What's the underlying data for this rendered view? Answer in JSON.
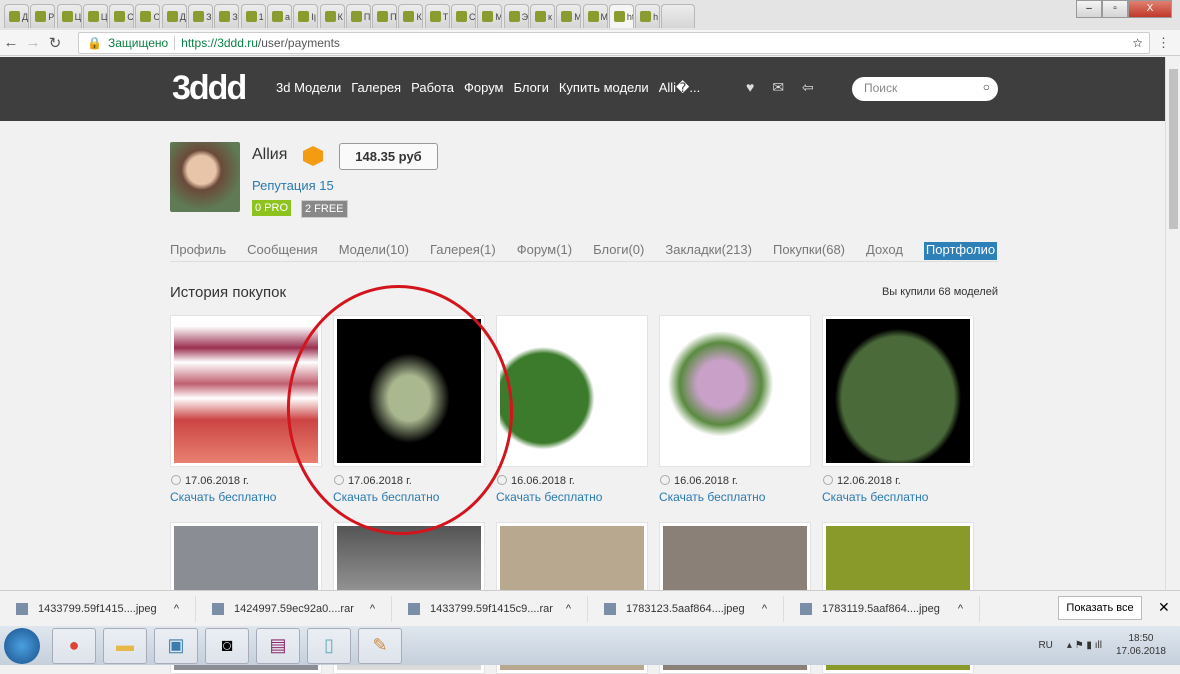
{
  "browser": {
    "tabs": [
      "Д",
      "Р",
      "Ц",
      "Ц",
      "С",
      "О",
      "Д",
      "З",
      "З",
      "1",
      "a",
      "Iן",
      "К",
      "П",
      "П",
      "К",
      "Т",
      "С",
      "М",
      "Э",
      "к",
      "М",
      "М",
      "ht",
      "h"
    ],
    "active_tab": 23,
    "close": "X",
    "secure_label": "Защищено",
    "url_host": "https://3ddd.ru",
    "url_path": "/user/payments"
  },
  "site": {
    "logo": "3ddd",
    "menu": [
      "3d Модели",
      "Галерея",
      "Работа",
      "Форум",
      "Блоги",
      "Купить модели",
      "Alli�..."
    ],
    "search_placeholder": "Поиск"
  },
  "profile": {
    "name": "Allия",
    "balance": "148.35 руб",
    "reputation": "Репутация 15",
    "pro": "0 PRO",
    "free": "2 FREE"
  },
  "tabs": [
    "Профиль",
    "Сообщения",
    "Модели(10)",
    "Галерея(1)",
    "Форум(1)",
    "Блоги(0)",
    "Закладки(213)",
    "Покупки(68)",
    "Доход",
    "Портфолио"
  ],
  "purchases": {
    "title": "История покупок",
    "count": "Вы купили 68 моделей",
    "download_label": "Скачать бесплатно",
    "items": [
      {
        "date": "17.06.2018 г."
      },
      {
        "date": "17.06.2018 г."
      },
      {
        "date": "16.06.2018 г."
      },
      {
        "date": "16.06.2018 г."
      },
      {
        "date": "12.06.2018 г."
      }
    ]
  },
  "downloads": {
    "files": [
      "1433799.59f1415....jpeg",
      "1424997.59ec92a0....rar",
      "1433799.59f1415c9....rar",
      "1783123.5aaf864....jpeg",
      "1783119.5aaf864....jpeg"
    ],
    "show_all": "Показать все"
  },
  "taskbar": {
    "lang": "RU",
    "time": "18:50",
    "date": "17.06.2018"
  },
  "colors": {
    "accent": "#2e80b8",
    "header": "#3e3e3e",
    "pro": "#8dc21f",
    "annotation": "#d3141c"
  }
}
